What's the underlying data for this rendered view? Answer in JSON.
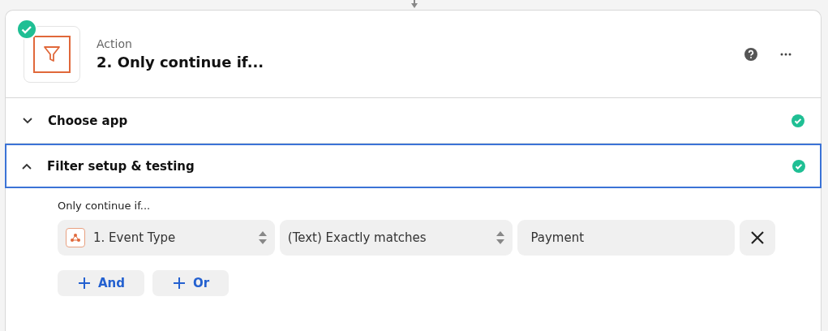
{
  "step": {
    "label": "Action",
    "title": "2. Only continue if...",
    "completed": true
  },
  "sections": [
    {
      "title": "Choose app",
      "expanded": false,
      "selected": false,
      "complete": true
    },
    {
      "title": "Filter setup & testing",
      "expanded": true,
      "selected": true,
      "complete": true
    }
  ],
  "filter": {
    "label": "Only continue if...",
    "conditions": [
      {
        "field": "1. Event Type",
        "operator": "(Text) Exactly matches",
        "value": "Payment"
      }
    ],
    "buttons": [
      "And",
      "Or"
    ]
  }
}
